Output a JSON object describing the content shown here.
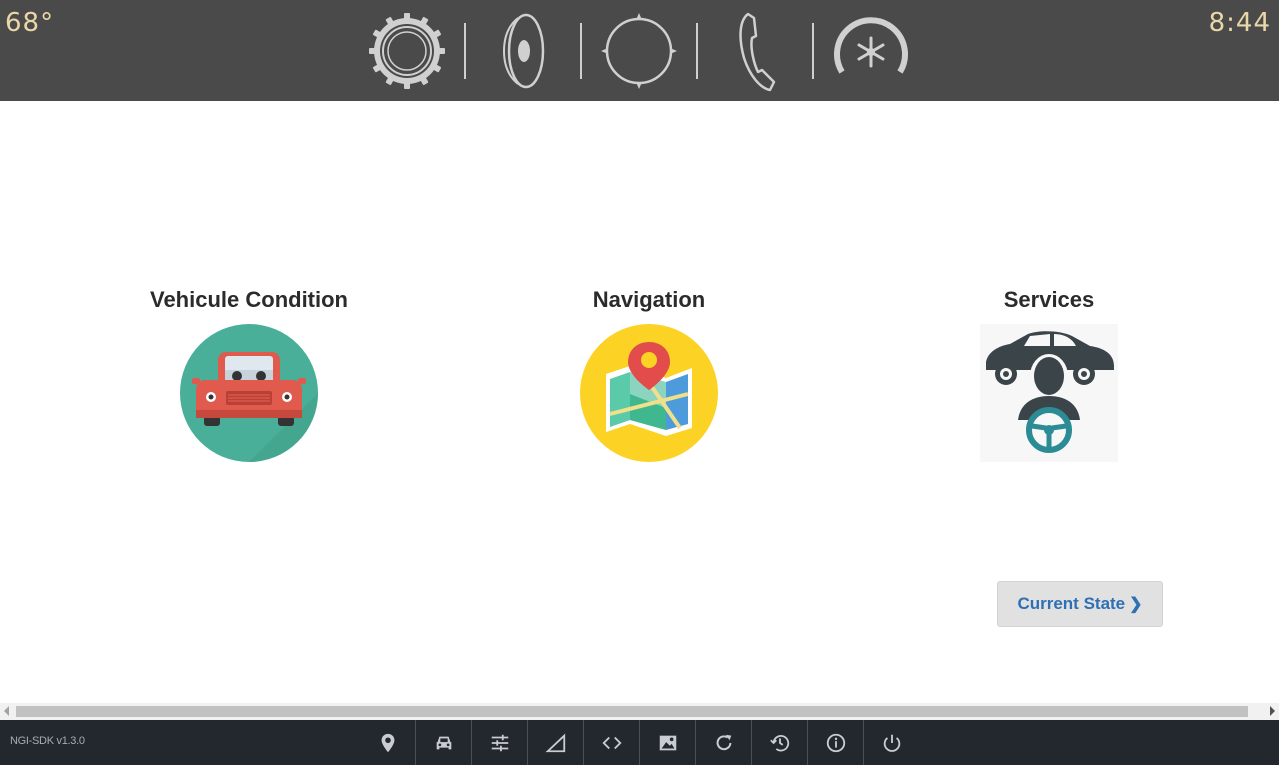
{
  "status": {
    "temperature": "68°",
    "time": "8:44"
  },
  "top_icons": [
    "settings-gear-icon",
    "audio-speaker-icon",
    "navigation-compass-icon",
    "phone-icon",
    "climate-fan-icon"
  ],
  "tiles": [
    {
      "title": "Vehicule Condition",
      "icon": "car-front-icon"
    },
    {
      "title": "Navigation",
      "icon": "map-pin-icon"
    },
    {
      "title": "Services",
      "icon": "driver-service-icon"
    }
  ],
  "current_state_button": {
    "label": "Current State",
    "chevron": "❯"
  },
  "footer": {
    "version": "NGI-SDK v1.3.0",
    "tools": [
      "location-pin-icon",
      "car-icon",
      "sliders-icon",
      "signal-triangle-icon",
      "code-icon",
      "image-icon",
      "refresh-icon",
      "history-icon",
      "info-icon",
      "power-icon"
    ]
  },
  "colors": {
    "topbar": "#4a4a4a",
    "accent_text": "#e9d7a8",
    "button_text": "#2f6fb3",
    "footer": "#23272e"
  }
}
